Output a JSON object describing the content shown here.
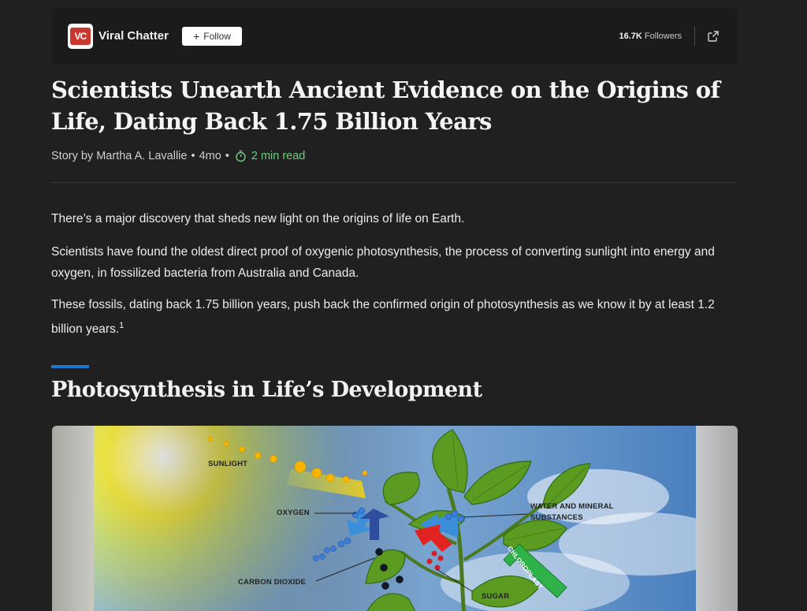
{
  "header": {
    "publisher_name": "Viral Chatter",
    "logo_text": "VC",
    "follow_label": "Follow",
    "followers_count": "16.7K",
    "followers_label": "Followers"
  },
  "article": {
    "title": "Scientists Unearth Ancient Evidence on the Origins of Life, Dating Back 1.75 Billion Years",
    "byline_author": "Story by Martha A. Lavallie",
    "byline_age": "4mo",
    "separator": "•",
    "read_time": "2 min read",
    "paragraphs": [
      "There’s a major discovery that sheds new light on the origins of life on Earth.",
      "Scientists have found the oldest direct proof of oxygenic photosynthesis, the process of converting sunlight into energy and oxygen, in fossilized bacteria from Australia and Canada.",
      "These fossils, dating back 1.75 billion years, push back the confirmed origin of photosynthesis as we know it by at least 1.2 billion years."
    ],
    "footnote_ref": "1",
    "section_heading": "Photosynthesis in Life’s Development"
  },
  "figure": {
    "labels": {
      "sunlight": "SUNLIGHT",
      "oxygen": "OXYGEN",
      "water_line1": "WATER AND MINERAL",
      "water_line2": "SUBSTANCES",
      "chloroplast": "CHLOROPLAST",
      "carbon_dioxide": "CARBON DIOXIDE",
      "sugar": "SUGAR"
    }
  },
  "colors": {
    "background": "#202020",
    "header_bar": "#1b1b1b",
    "accent_blue": "#1b78d0",
    "read_time_green": "#6ccf7f",
    "logo_red": "#c8382e"
  }
}
